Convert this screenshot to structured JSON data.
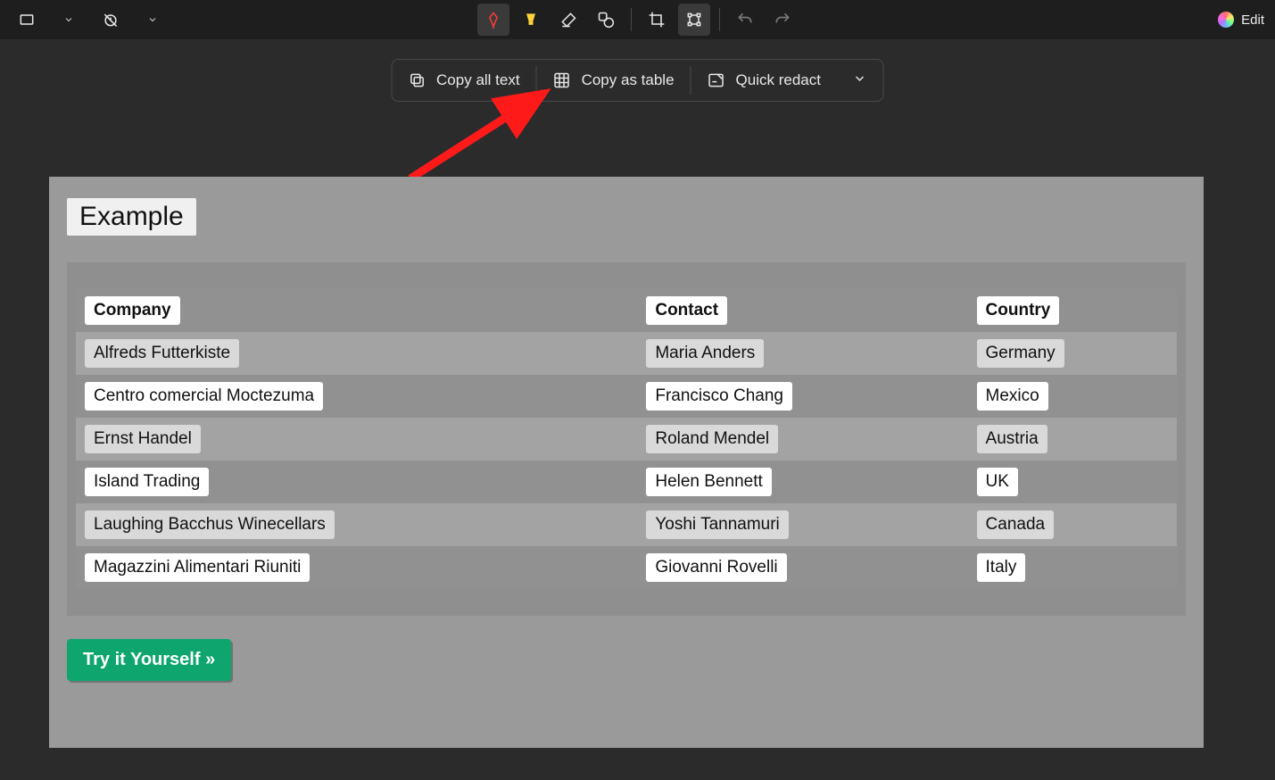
{
  "toolbar": {
    "edit_label": "Edit"
  },
  "actions": {
    "copy_all_text": "Copy all text",
    "copy_as_table": "Copy as table",
    "quick_redact": "Quick redact"
  },
  "page": {
    "heading": "Example",
    "try_button": "Try it Yourself »",
    "table": {
      "headers": [
        "Company",
        "Contact",
        "Country"
      ],
      "rows": [
        [
          "Alfreds Futterkiste",
          "Maria Anders",
          "Germany"
        ],
        [
          "Centro comercial Moctezuma",
          "Francisco Chang",
          "Mexico"
        ],
        [
          "Ernst Handel",
          "Roland Mendel",
          "Austria"
        ],
        [
          "Island Trading",
          "Helen Bennett",
          "UK"
        ],
        [
          "Laughing Bacchus Winecellars",
          "Yoshi Tannamuri",
          "Canada"
        ],
        [
          "Magazzini Alimentari Riuniti",
          "Giovanni Rovelli",
          "Italy"
        ]
      ]
    }
  }
}
